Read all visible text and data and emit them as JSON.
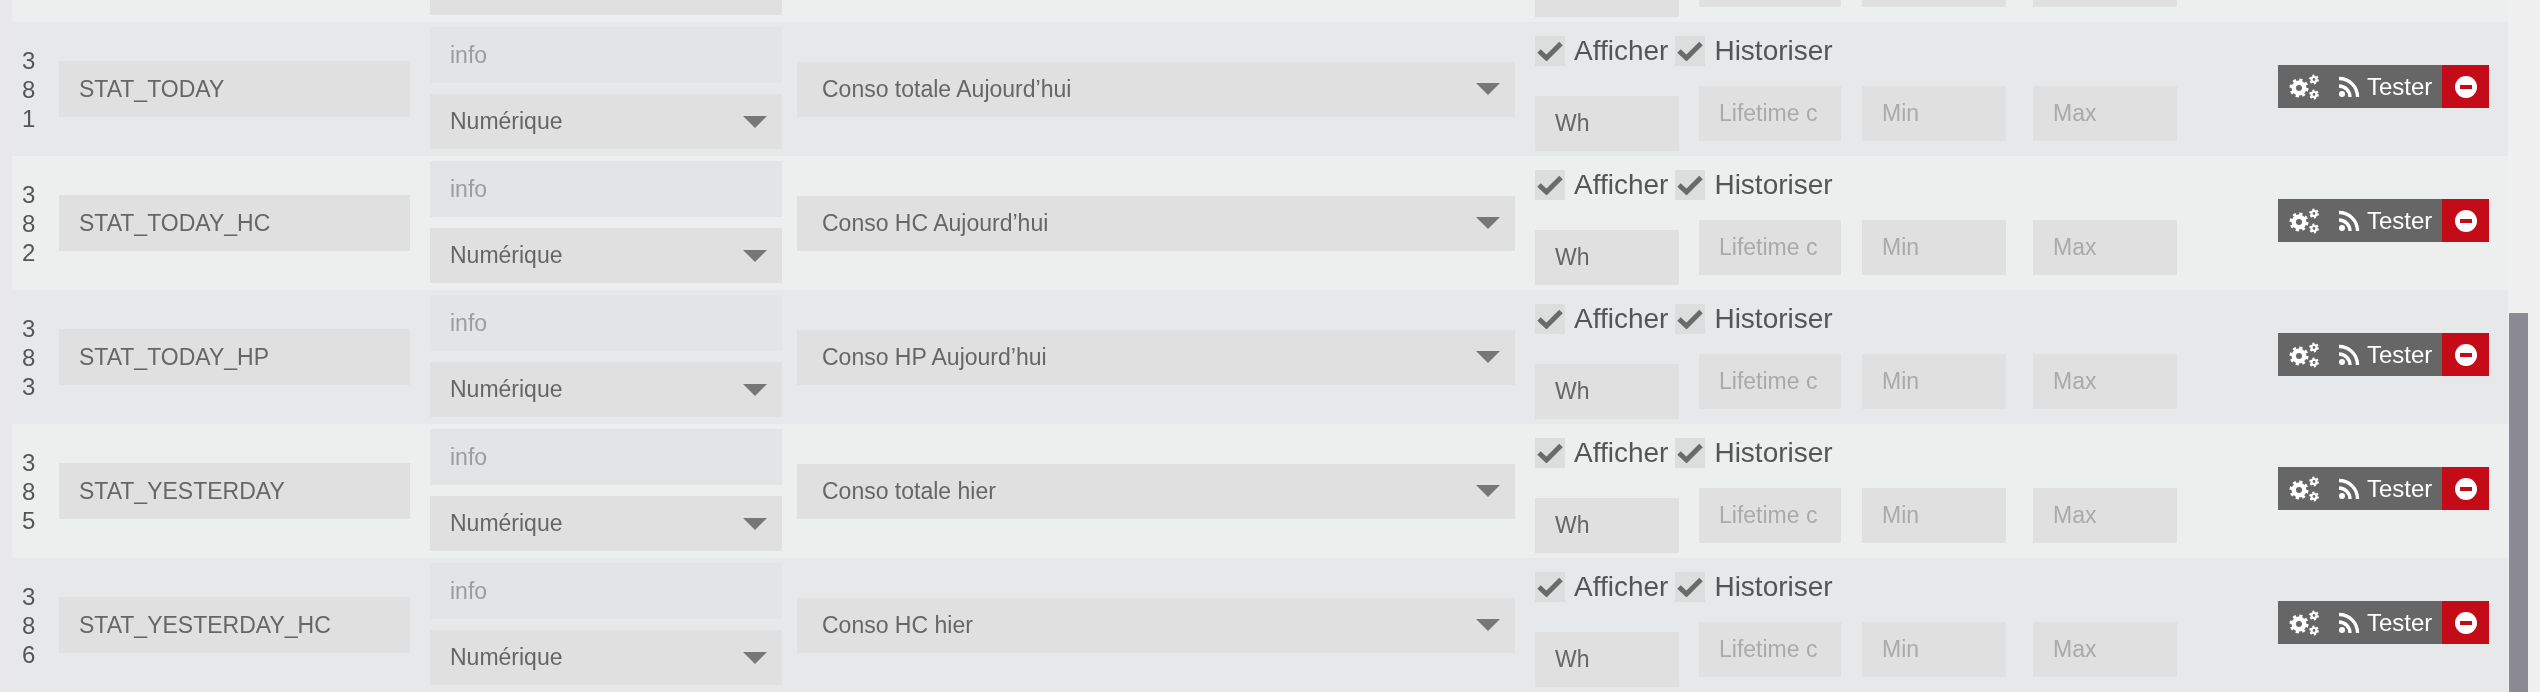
{
  "rows": [
    {
      "number": "381",
      "name": "STAT_TODAY",
      "type": {
        "value": "info",
        "disabled": true
      },
      "subtype": "Numérique",
      "generic_type": "Conso totale Aujourd’hui",
      "checkboxes": [
        {
          "label": "Afficher",
          "checked": true
        },
        {
          "label": "Historiser",
          "checked": true
        }
      ],
      "unit": "Wh",
      "inputs": [
        {
          "placeholder": "Lifetime c"
        },
        {
          "placeholder": "Min"
        },
        {
          "placeholder": "Max"
        }
      ],
      "test_button": "Tester"
    },
    {
      "number": "382",
      "name": "STAT_TODAY_HC",
      "type": {
        "value": "info",
        "disabled": true
      },
      "subtype": "Numérique",
      "generic_type": "Conso HC Aujourd’hui",
      "checkboxes": [
        {
          "label": "Afficher",
          "checked": true
        },
        {
          "label": "Historiser",
          "checked": true
        }
      ],
      "unit": "Wh",
      "inputs": [
        {
          "placeholder": "Lifetime c"
        },
        {
          "placeholder": "Min"
        },
        {
          "placeholder": "Max"
        }
      ],
      "test_button": "Tester"
    },
    {
      "number": "383",
      "name": "STAT_TODAY_HP",
      "type": {
        "value": "info",
        "disabled": true
      },
      "subtype": "Numérique",
      "generic_type": "Conso HP Aujourd’hui",
      "checkboxes": [
        {
          "label": "Afficher",
          "checked": true
        },
        {
          "label": "Historiser",
          "checked": true
        }
      ],
      "unit": "Wh",
      "inputs": [
        {
          "placeholder": "Lifetime c"
        },
        {
          "placeholder": "Min"
        },
        {
          "placeholder": "Max"
        }
      ],
      "test_button": "Tester"
    },
    {
      "number": "385",
      "name": "STAT_YESTERDAY",
      "type": {
        "value": "info",
        "disabled": true
      },
      "subtype": "Numérique",
      "generic_type": "Conso totale hier",
      "checkboxes": [
        {
          "label": "Afficher",
          "checked": true
        },
        {
          "label": "Historiser",
          "checked": true
        }
      ],
      "unit": "Wh",
      "inputs": [
        {
          "placeholder": "Lifetime c"
        },
        {
          "placeholder": "Min"
        },
        {
          "placeholder": "Max"
        }
      ],
      "test_button": "Tester"
    },
    {
      "number": "386",
      "name": "STAT_YESTERDAY_HC",
      "type": {
        "value": "info",
        "disabled": true
      },
      "subtype": "Numérique",
      "generic_type": "Conso HC hier",
      "checkboxes": [
        {
          "label": "Afficher",
          "checked": true
        },
        {
          "label": "Historiser",
          "checked": true
        }
      ],
      "unit": "Wh",
      "inputs": [
        {
          "placeholder": "Lifetime c"
        },
        {
          "placeholder": "Min"
        },
        {
          "placeholder": "Max"
        }
      ],
      "test_button": "Tester"
    }
  ]
}
